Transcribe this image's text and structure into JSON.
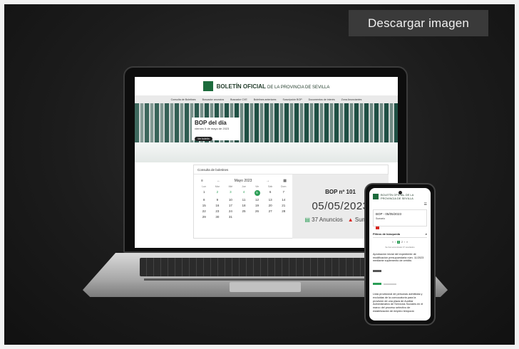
{
  "download_button": {
    "label": "Descargar imagen"
  },
  "site": {
    "title_bold": "BOLETÍN OFICIAL",
    "title_rest": "DE LA PROVINCIA DE SEVILLA",
    "nav": [
      "Consulta de Boletines",
      "Buscador anuncios",
      "Buscador CVE",
      "Boletines anteriores",
      "Suscripción BOP",
      "Documentos de interés",
      "Zona Anunciantes"
    ],
    "hero": {
      "heading": "BOP del día",
      "date": "viernes 5 de mayo de 2023",
      "button": "Ver boletín"
    },
    "consulta": {
      "title": "Consulta de boletines",
      "calendar": {
        "month": "Mayo 2023",
        "prev": "←",
        "next": "→",
        "menu": "≡",
        "grid_icon": "▦",
        "day_names": [
          "Lun",
          "Mar",
          "Mié",
          "Jue",
          "Vie",
          "Sáb",
          "Dom"
        ],
        "days": [
          [
            "1",
            "2",
            "3",
            "4",
            "5",
            "6",
            "7"
          ],
          [
            "8",
            "9",
            "10",
            "11",
            "12",
            "13",
            "14"
          ],
          [
            "15",
            "16",
            "17",
            "18",
            "19",
            "20",
            "21"
          ],
          [
            "22",
            "23",
            "24",
            "25",
            "26",
            "27",
            "28"
          ],
          [
            "29",
            "30",
            "31",
            "",
            "",
            "",
            ""
          ]
        ]
      },
      "bop_number": "BOP nº 101",
      "bop_date": "05/05/2023",
      "anuncios": "37 Anuncios",
      "sumario": "Sumario"
    }
  },
  "phone": {
    "title": "BOLETÍN OFICIAL DE LA PROVINCIA DE SEVILLA",
    "bop_label": "BOP - 05/05/2023",
    "sumario_label": "Sumario",
    "filters_title": "Filtros de búsqueda",
    "pager": [
      "«",
      "‹",
      "1",
      "2",
      "›",
      "»"
    ],
    "results": "Se han encontrado 37 resultados",
    "items": [
      "Aprobación inicial del expediente de modificación presupuestaria núm. 11/2023 mediante suplemento de crédito.",
      "Lista provisional de personas admitidas y excluidas de la convocatoria para la provisión de una plaza de Auxiliar Administrativo de Servicios Sociales en el marco del proceso selectivo de estabilización de empleo temporal."
    ]
  }
}
